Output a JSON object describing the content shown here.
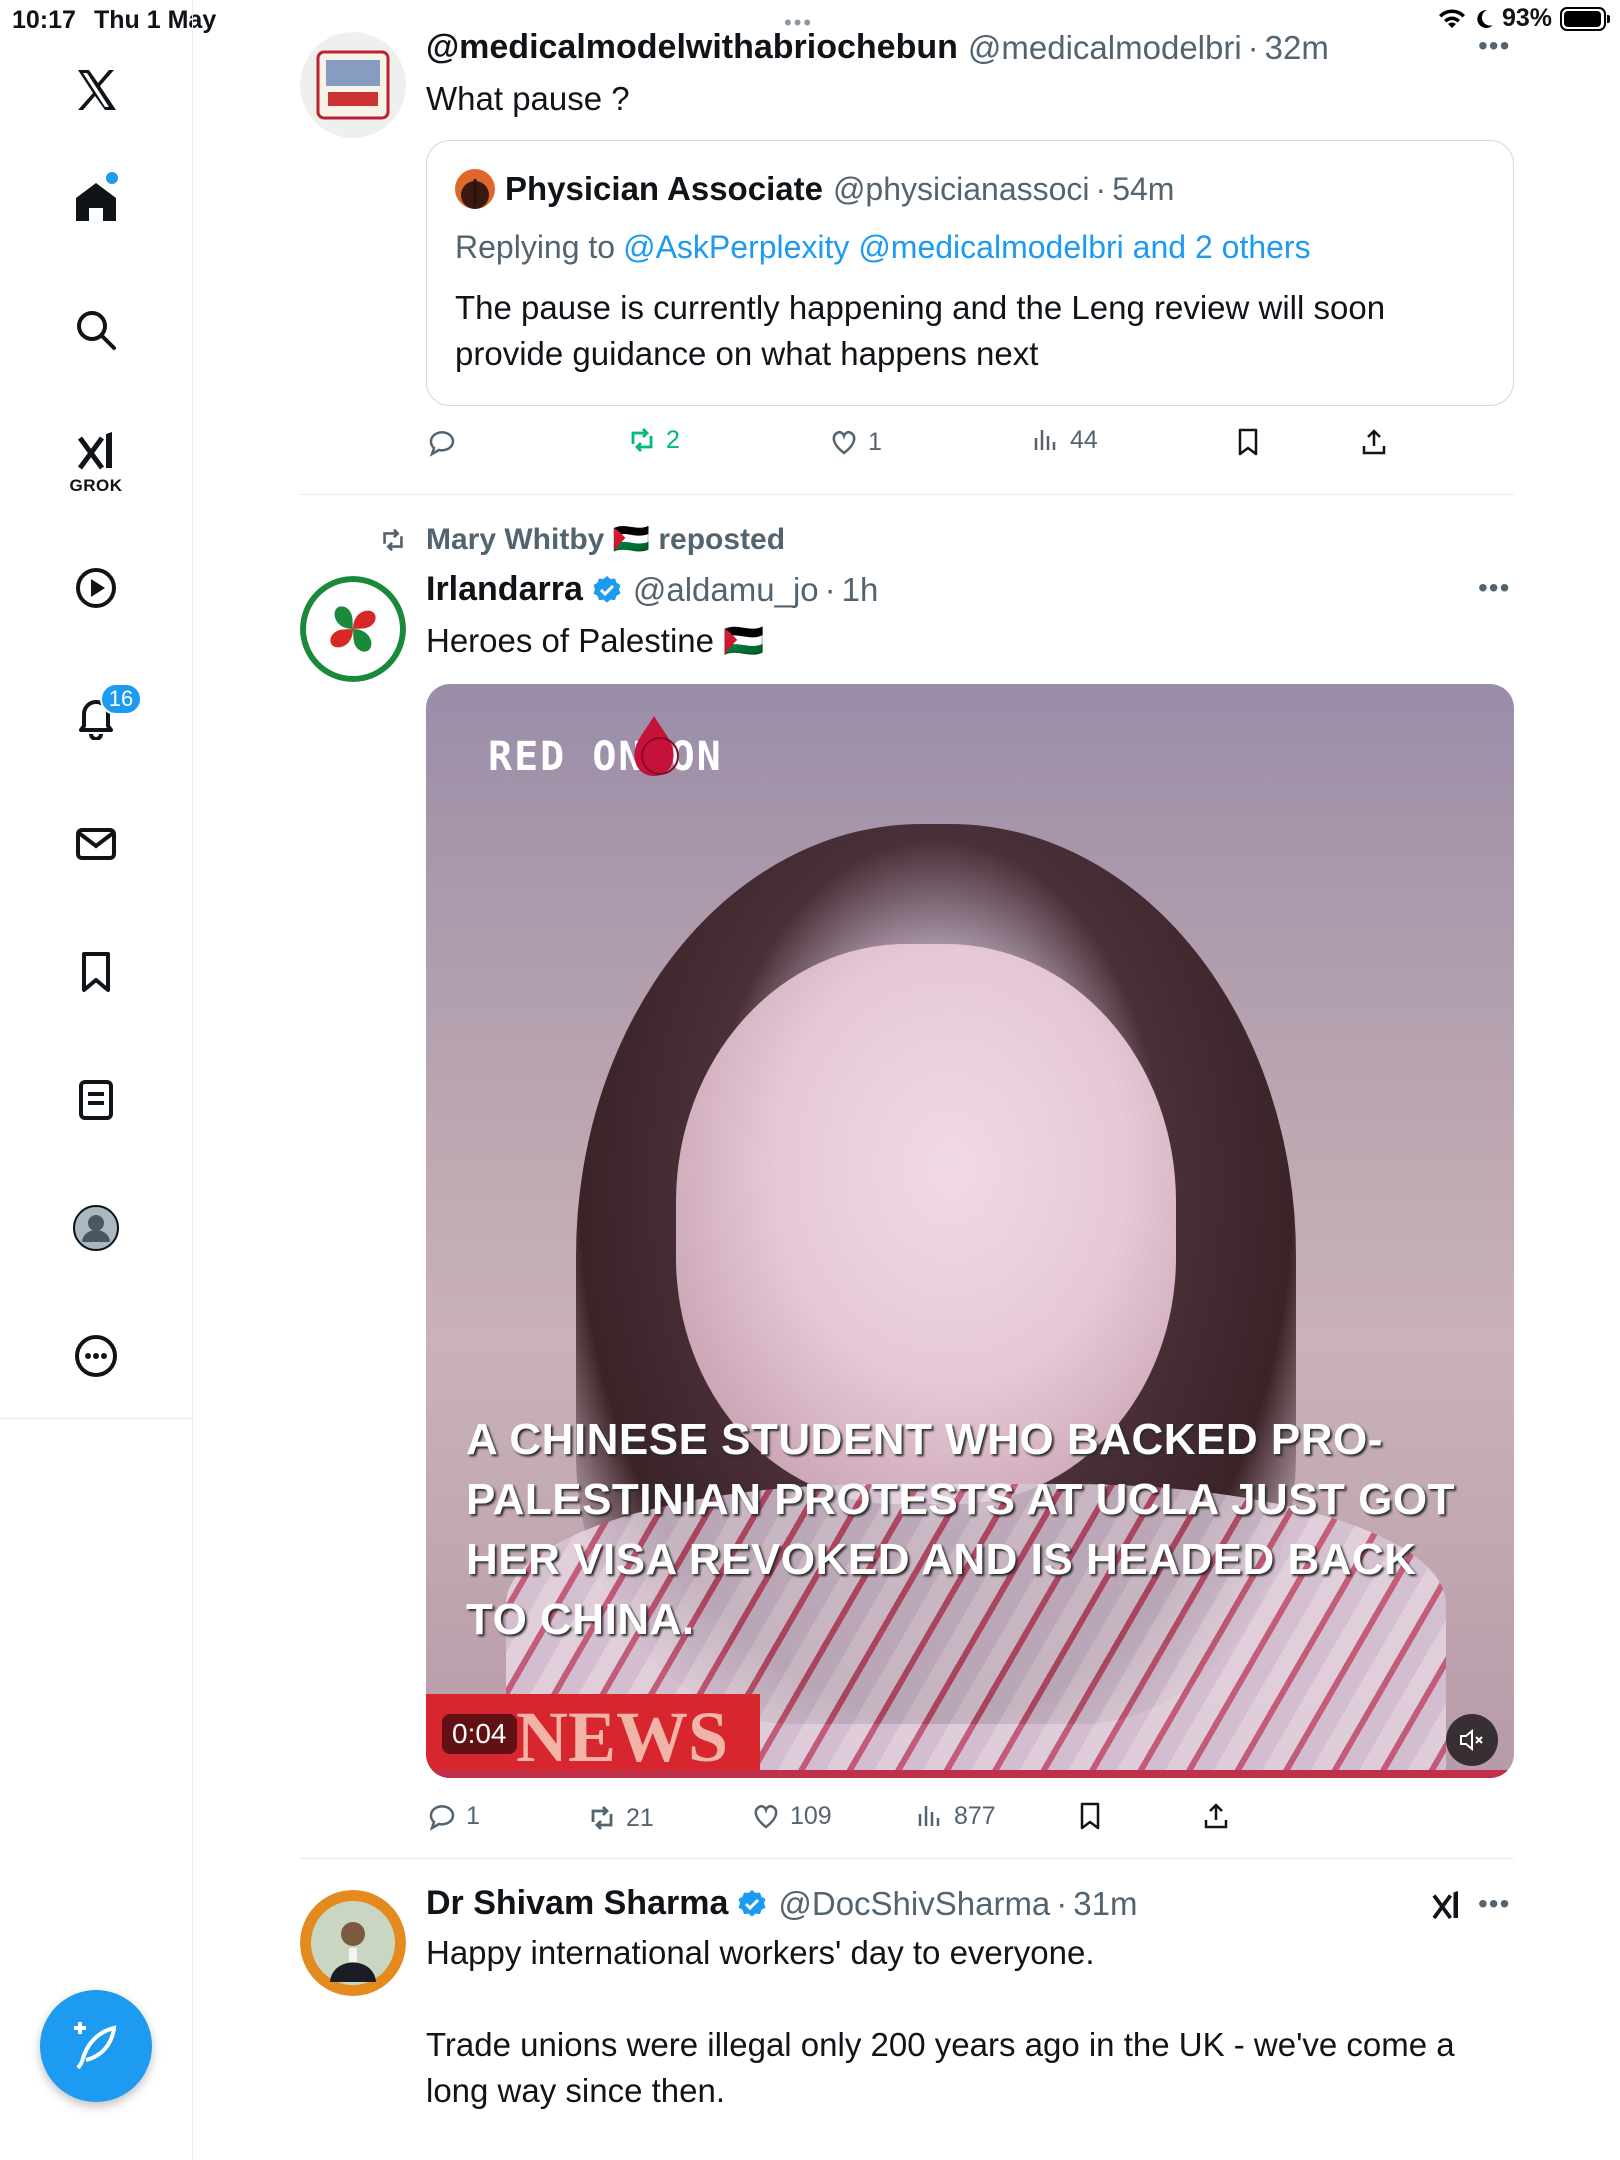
{
  "status_bar": {
    "time": "10:17",
    "date": "Thu 1 May",
    "battery": "93%"
  },
  "sidebar": {
    "grok_label": "GROK",
    "notifications_badge": "16"
  },
  "tweets": [
    {
      "display_name": "@medicalmodelwithabriochebun",
      "handle": "@medicalmodelbri",
      "time": "32m",
      "text": "What pause ?",
      "quote": {
        "display_name": "Physician Associate",
        "handle": "@physicianassoci",
        "time": "54m",
        "replying_prefix": "Replying to ",
        "replying_to": "@AskPerplexity @medicalmodelbri and 2 others",
        "text": "The pause is currently happening and the Leng review will soon provide guidance on what happens next"
      },
      "stats": {
        "replies": "",
        "reposts": "2",
        "likes": "1",
        "views": "44"
      }
    },
    {
      "repost_label": "Mary Whitby 🇵🇸 reposted",
      "display_name": "Irlandarra",
      "handle": "@aldamu_jo",
      "time": "1h",
      "text": "Heroes of Palestine 🇵🇸",
      "media": {
        "watermark": "RED ONION",
        "caption": "A CHINESE STUDENT WHO BACKED PRO-PALESTINIAN PROTESTS AT UCLA JUST GOT HER VISA REVOKED AND IS HEADED BACK TO CHINA.",
        "banner": "NEWS",
        "duration": "0:04"
      },
      "stats": {
        "replies": "1",
        "reposts": "21",
        "likes": "109",
        "views": "877"
      }
    },
    {
      "display_name": "Dr Shivam Sharma",
      "handle": "@DocShivSharma",
      "time": "31m",
      "text_line1": "Happy international workers' day to everyone.",
      "text_line2": "Trade unions were illegal only 200 years ago in the UK - we've come a long way since then."
    }
  ],
  "colors": {
    "accent": "#1d9bf0",
    "repost_green": "#00ba7c",
    "muted": "#536471",
    "border": "#e6ecf0"
  }
}
